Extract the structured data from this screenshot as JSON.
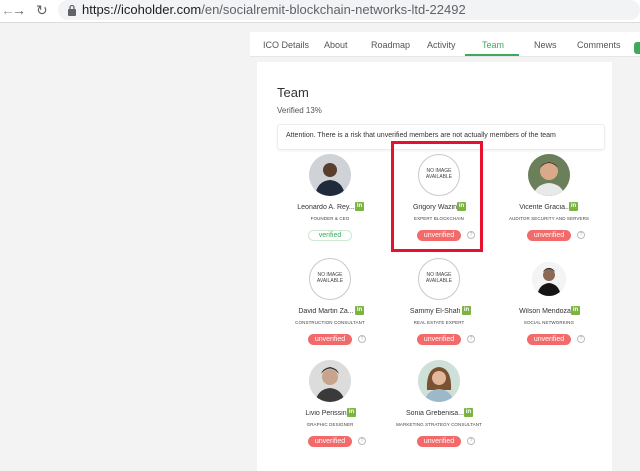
{
  "browser": {
    "url_host": "https://icoholder.com",
    "url_path": "/en/socialremit-blockchain-networks-ltd-22492",
    "back_icon": "arrow-left-icon",
    "forward_icon": "arrow-right-icon",
    "reload_icon": "reload-icon",
    "lock_icon": "lock-icon"
  },
  "tabs": [
    {
      "label": "ICO Details"
    },
    {
      "label": "About"
    },
    {
      "label": "Roadmap"
    },
    {
      "label": "Activity"
    },
    {
      "label": "Team"
    },
    {
      "label": "News"
    },
    {
      "label": "Comments"
    }
  ],
  "team": {
    "title": "Team",
    "verified_percent": "Verified 13%",
    "attention": "Attention. There is a risk that unverified members are not actually members of the team"
  },
  "no_image_text": "NO IMAGE AVAILABLE",
  "members": [
    {
      "name": "Leonardo A. Rey...",
      "role": "FOUNDER & CEO",
      "status": "verified"
    },
    {
      "name": "Grigory Wazin",
      "role": "EXPERT BLOCKCHAIN",
      "status": "unverified"
    },
    {
      "name": "Vicente Gracia...",
      "role": "AUDITOR SECURITY AND SERVERS",
      "status": "unverified"
    },
    {
      "name": "David Martin Za...",
      "role": "CONSTRUCTION CONSULTANT",
      "status": "unverified"
    },
    {
      "name": "Sammy El-Shafi",
      "role": "REAL ESTATE EXPERT",
      "status": "unverified"
    },
    {
      "name": "Wilson Mendoza",
      "role": "SOCIAL NETWORKING",
      "status": "unverified"
    },
    {
      "name": "Livio Perissin",
      "role": "GRAPHIC DESIGNER",
      "status": "unverified"
    },
    {
      "name": "Sonia Grebenisa...",
      "role": "MARKETING STRATEGY CONSULTANT",
      "status": "unverified"
    }
  ],
  "linkedin_label": "in",
  "help_label": "?",
  "colors": {
    "accent_green": "#3fa85c",
    "unverified_red": "#f36a6a",
    "highlight_red": "#e8102f",
    "linkedin_green": "#7cb342"
  }
}
